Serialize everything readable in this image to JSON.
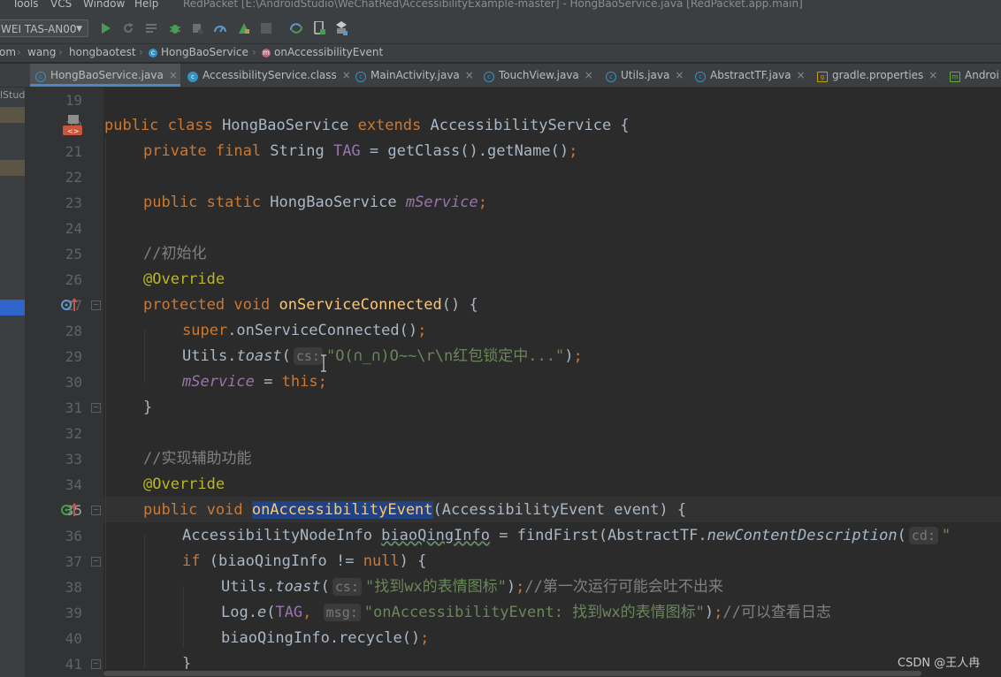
{
  "menubar": {
    "items": [
      "Tools",
      "VCS",
      "Window",
      "Help"
    ],
    "window_title": "RedPacket [E:\\AndroidStudio\\WeChatRed\\AccessibilityExample-master] - HongBaoService.java [RedPacket.app.main]"
  },
  "toolbar": {
    "device": "WEI TAS-AN00",
    "icons": [
      "run-icon",
      "rerun-icon",
      "apply-changes-icon",
      "debug-icon",
      "attach-debugger-icon",
      "profile-icon",
      "coverage-icon",
      "stop-icon",
      "sync-icon",
      "device-manager-icon",
      "sdk-manager-icon"
    ]
  },
  "breadcrumb": [
    "om",
    "wang",
    "hongbaotest",
    "HongBaoService",
    "onAccessibilityEvent"
  ],
  "tabs": [
    {
      "label": "HongBaoService.java",
      "active": true
    },
    {
      "label": "AccessibilityService.class",
      "active": false
    },
    {
      "label": "MainActivity.java",
      "active": false
    },
    {
      "label": "TouchView.java",
      "active": false
    },
    {
      "label": "Utils.java",
      "active": false
    },
    {
      "label": "AbstractTF.java",
      "active": false
    },
    {
      "label": "gradle.properties",
      "active": false
    },
    {
      "label": "Androi",
      "active": false
    }
  ],
  "left_panel": {
    "label": "lStud"
  },
  "line_numbers": [
    "19",
    "20",
    "21",
    "22",
    "23",
    "24",
    "25",
    "26",
    "27",
    "28",
    "29",
    "30",
    "31",
    "32",
    "33",
    "34",
    "35",
    "36",
    "37",
    "38",
    "39",
    "40",
    "41"
  ],
  "current_line": "35",
  "code": {
    "l20": {
      "kw1": "public class ",
      "name": "HongBaoService ",
      "kw2": "extends ",
      "rest": "AccessibilityService {"
    },
    "l21": {
      "kw": "private final ",
      "type": "String ",
      "field": "TAG",
      "rest": " = getClass().getName()",
      "semi": ";"
    },
    "l23": {
      "kw": "public static ",
      "type": "HongBaoService ",
      "field": "mService",
      "semi": ";"
    },
    "l25": {
      "comment": "//初始化"
    },
    "l26": {
      "ann": "@Override"
    },
    "l27": {
      "kw": "protected void ",
      "method": "onServiceConnected",
      "rest": "() {"
    },
    "l28": {
      "kw": "super",
      "rest": ".onServiceConnected()",
      "semi": ";"
    },
    "l29": {
      "cls": "Utils.",
      "method": "toast",
      "open": "(",
      "hint": "cs:",
      "str": "\"O(∩_∩)O~~\\r\\n红包锁定中...\"",
      "close": ")",
      "semi": ";"
    },
    "l30": {
      "field": "mService",
      "rest": " = ",
      "kw": "this",
      "semi": ";"
    },
    "l31": {
      "rest": "}"
    },
    "l33": {
      "comment": "//实现辅助功能"
    },
    "l34": {
      "ann": "@Override"
    },
    "l35": {
      "kw": "public void ",
      "method": "onAccessibilityEvent",
      "rest": "(AccessibilityEvent event) {"
    },
    "l36": {
      "type": "AccessibilityNodeInfo ",
      "var": "biaoQingInfo",
      "rest1": " = findFirst(AbstractTF.",
      "method": "newContentDescription",
      "open": "(",
      "hint": "cd:",
      "tail": "\""
    },
    "l37": {
      "kw": "if ",
      "rest1": "(biaoQingInfo != ",
      "kw2": "null",
      "rest2": ") {"
    },
    "l38": {
      "cls": "Utils.",
      "method": "toast",
      "open": "(",
      "hint": "cs:",
      "str": "\"找到wx的表情图标\"",
      "close": ")",
      "semi": ";",
      "comment": "//第一次运行可能会吐不出来"
    },
    "l39": {
      "cls": "Log.",
      "method": "e",
      "open": "(",
      "field": "TAG",
      "comma": ", ",
      "hint": "msg:",
      "str": "\"onAccessibilityEvent: 找到wx的表情图标\"",
      "close": ")",
      "semi": ";",
      "comment": "//可以查看日志"
    },
    "l40": {
      "rest": "biaoQingInfo.recycle()",
      "semi": ";"
    },
    "l41": {
      "rest": "}"
    }
  },
  "watermark": "CSDN @王人冉",
  "colors": {
    "background": "#2b2b2b",
    "keyword": "#cc7832",
    "string": "#6a8759",
    "method": "#ffc66d",
    "field": "#9876aa",
    "annotation": "#bbb529",
    "comment": "#808080",
    "selection": "#214283"
  }
}
